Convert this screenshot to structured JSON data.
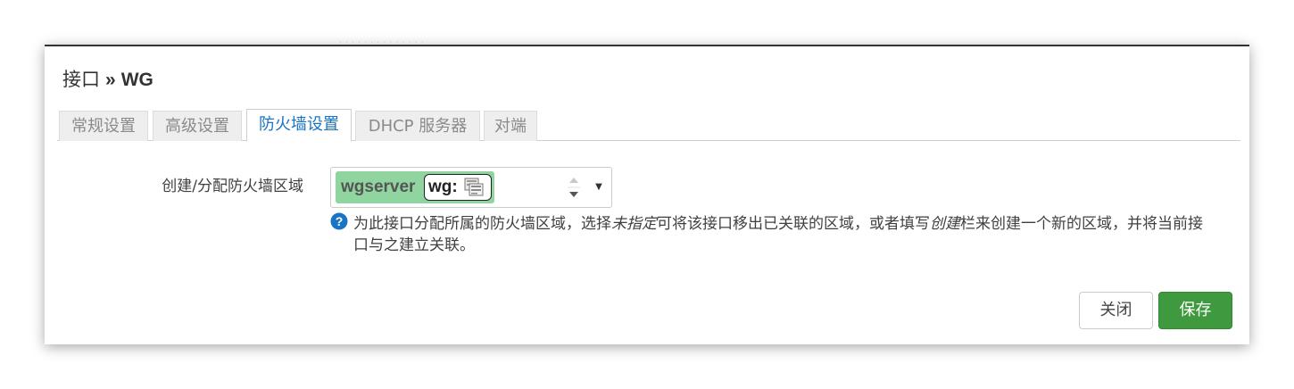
{
  "title": {
    "prefix": "接口",
    "separator": "»",
    "name": "WG"
  },
  "tabs": [
    {
      "label": "常规设置",
      "active": false
    },
    {
      "label": "高级设置",
      "active": false
    },
    {
      "label": "防火墙设置",
      "active": true
    },
    {
      "label": "DHCP 服务器",
      "active": false
    },
    {
      "label": "对端",
      "active": false
    }
  ],
  "firewall": {
    "label": "创建/分配防火墙区域",
    "zone_name": "wgserver",
    "zone_color": "#90d4a0",
    "interface_name": "wg:",
    "interface_icon": "network-interface-icon"
  },
  "help": {
    "icon": "question-circle-icon",
    "part1": "为此接口分配所属的防火墙区域，选择",
    "em1": "未指定",
    "part2": "可将该接口移出已关联的区域，或者填写",
    "em2": "创建",
    "part3": "栏来创建一个新的区域，并将当前接口与之建立关联。"
  },
  "buttons": {
    "close": "关闭",
    "save": "保存"
  },
  "colors": {
    "active_tab": "#1a74c4",
    "save_button": "#3f9a3f",
    "help_icon": "#1a74c4"
  }
}
